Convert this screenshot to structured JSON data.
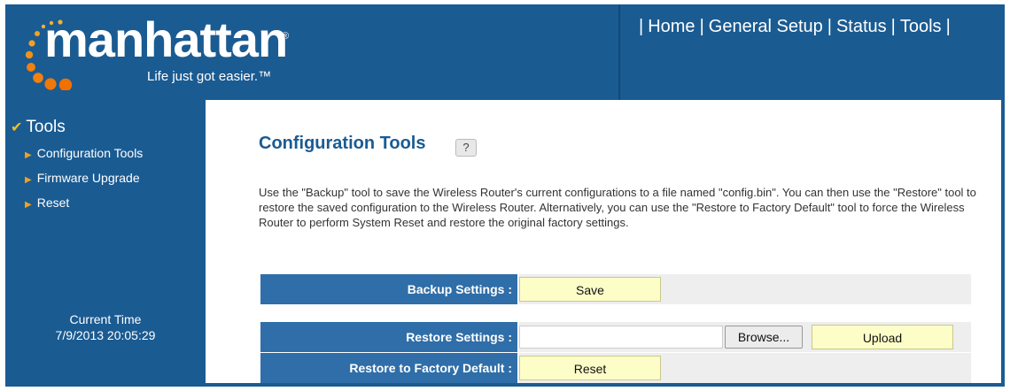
{
  "brand": {
    "logo_text": "manhattan",
    "logo_reg": "®",
    "tagline": "Life just got easier.™"
  },
  "topnav": {
    "items": [
      "Home",
      "General Setup",
      "Status",
      "Tools"
    ],
    "separator": "|"
  },
  "sidebar": {
    "section_title": "Tools",
    "items": [
      {
        "label": "Configuration Tools"
      },
      {
        "label": "Firmware Upgrade"
      },
      {
        "label": "Reset"
      }
    ],
    "current_time_label": "Current Time",
    "current_time_value": "7/9/2013 20:05:29"
  },
  "main": {
    "title": "Configuration Tools",
    "help_icon_glyph": "?",
    "description": "Use the \"Backup\" tool to save the Wireless Router's current configurations to a file named \"config.bin\". You can then use the \"Restore\" tool to restore the saved configuration to the Wireless Router. Alternatively, you can use the \"Restore to Factory Default\" tool to force the Wireless Router to perform System Reset and restore the original factory settings.",
    "backup": {
      "label": "Backup Settings :",
      "button": "Save"
    },
    "restore": {
      "label": "Restore Settings :",
      "file_value": "",
      "browse_button": "Browse...",
      "upload_button": "Upload"
    },
    "factory": {
      "label": "Restore to Factory Default :",
      "button": "Reset"
    }
  },
  "colors": {
    "brand_blue": "#1a5b92",
    "label_blue": "#2f6ea8",
    "button_yellow": "#fdfdc8",
    "logo_orange": "#f0a020"
  }
}
